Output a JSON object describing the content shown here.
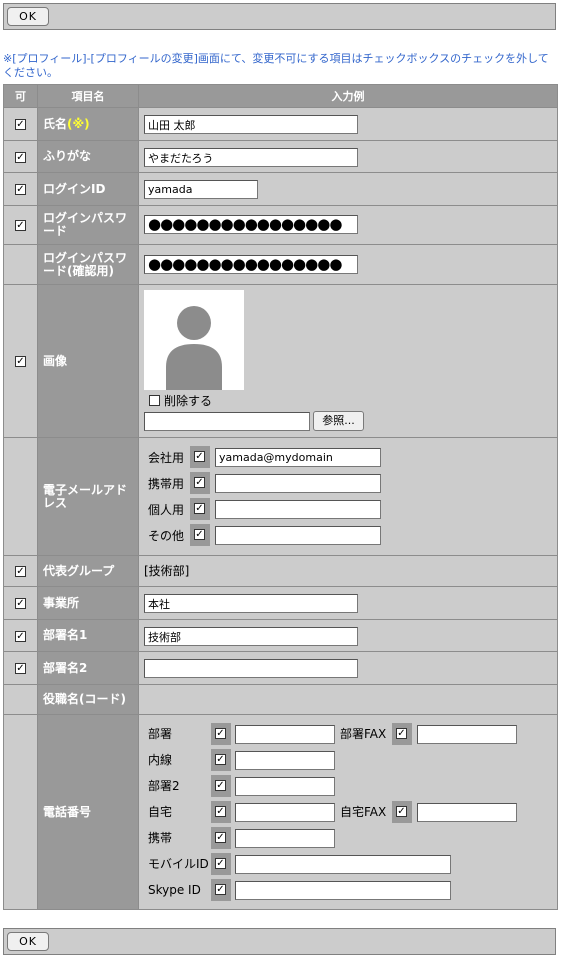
{
  "ok_button": "OK",
  "note": "※[プロフィール]-[プロフィールの変更]画面にて、変更不可にする項目はチェックボックスのチェックを外してください。",
  "header": {
    "col1": "可",
    "col2": "項目名",
    "col3": "入力例"
  },
  "rows": {
    "name": {
      "label": "氏名",
      "required_mark": "(※)",
      "value": "山田 太郎",
      "checked": true
    },
    "furigana": {
      "label": "ふりがな",
      "value": "やまだたろう",
      "checked": true
    },
    "login_id": {
      "label": "ログインID",
      "value": "yamada",
      "checked": true
    },
    "password": {
      "label": "ログインパスワード",
      "value": "●●●●●●●●●●●●●●●●",
      "checked": true
    },
    "password_confirm": {
      "label": "ログインパスワード(確認用)",
      "value": "●●●●●●●●●●●●●●●●"
    },
    "image": {
      "label": "画像",
      "delete_label": "削除する",
      "browse_label": "参照...",
      "checked": true
    },
    "email": {
      "label": "電子メールアドレス",
      "items": [
        {
          "label": "会社用",
          "value": "yamada@mydomain"
        },
        {
          "label": "携帯用",
          "value": ""
        },
        {
          "label": "個人用",
          "value": ""
        },
        {
          "label": "その他",
          "value": ""
        }
      ]
    },
    "group": {
      "label": "代表グループ",
      "value": "[技術部]",
      "checked": true
    },
    "office": {
      "label": "事業所",
      "value": "本社",
      "checked": true
    },
    "dept1": {
      "label": "部署名1",
      "value": "技術部",
      "checked": true
    },
    "dept2": {
      "label": "部署名2",
      "value": "",
      "checked": true
    },
    "position": {
      "label": "役職名(コード)"
    },
    "phone": {
      "label": "電話番号",
      "items": {
        "busho": "部署",
        "busho_fax": "部署FAX",
        "naisen": "内線",
        "busho2": "部署2",
        "jitaku": "自宅",
        "jitaku_fax": "自宅FAX",
        "keitai": "携帯",
        "mobile_id": "モバイルID",
        "skype_id": "Skype ID"
      }
    }
  },
  "colors": {
    "note": "#3366cc",
    "required": "#ffff33",
    "label_bg": "#999999",
    "cell_bg": "#cccccc"
  }
}
